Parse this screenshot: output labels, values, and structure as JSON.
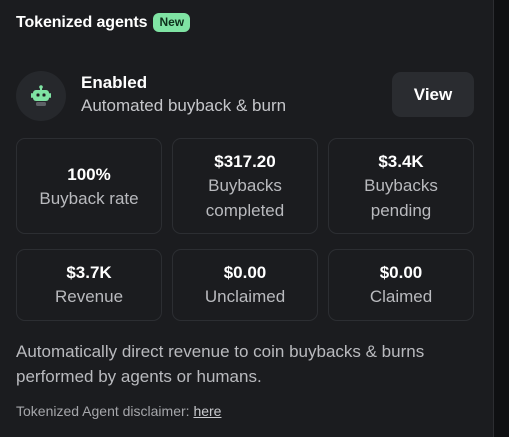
{
  "header": {
    "title": "Tokenized agents",
    "badge": "New"
  },
  "status": {
    "icon": "robot-icon",
    "title": "Enabled",
    "subtitle": "Automated buyback & burn",
    "view_label": "View"
  },
  "stats": [
    {
      "value": "100%",
      "label_lines": [
        "Buyback rate"
      ]
    },
    {
      "value": "$317.20",
      "label_lines": [
        "Buybacks",
        "completed"
      ]
    },
    {
      "value": "$3.4K",
      "label_lines": [
        "Buybacks",
        "pending"
      ]
    },
    {
      "value": "$3.7K",
      "label_lines": [
        "Revenue"
      ]
    },
    {
      "value": "$0.00",
      "label_lines": [
        "Unclaimed"
      ]
    },
    {
      "value": "$0.00",
      "label_lines": [
        "Claimed"
      ]
    }
  ],
  "description": "Automatically direct revenue to coin buybacks & burns performed by agents or humans.",
  "disclaimer": {
    "text": "Tokenized Agent disclaimer:",
    "link": "here"
  },
  "colors": {
    "badge_bg": "#7fe3a3",
    "agent_icon": "#7fe3a3",
    "panel_bg": "#1b1c1f",
    "card_border": "#2c2e32"
  }
}
